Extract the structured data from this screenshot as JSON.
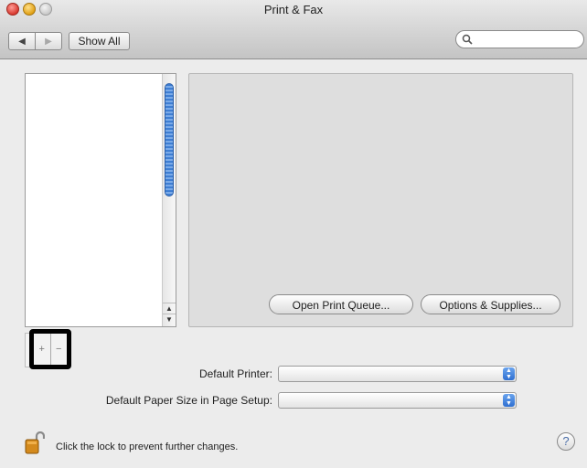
{
  "window": {
    "title": "Print & Fax"
  },
  "toolbar": {
    "back_icon": "left-triangle-icon",
    "forward_icon": "right-triangle-icon",
    "back_glyph": "◀",
    "forward_glyph": "▶",
    "show_all_label": "Show All",
    "search_placeholder": "",
    "search_glyph": "🔍"
  },
  "printer_list": {
    "items": []
  },
  "list_buttons": {
    "add_label": "+",
    "remove_label": "−"
  },
  "detail": {
    "open_queue_label": "Open Print Queue...",
    "options_label": "Options & Supplies..."
  },
  "settings": {
    "default_printer_label": "Default Printer:",
    "default_printer_value": "",
    "paper_size_label": "Default Paper Size in Page Setup:",
    "paper_size_value": ""
  },
  "footer": {
    "lock_text": "Click the lock to prevent further changes.",
    "help_label": "?"
  },
  "colors": {
    "titlebar": "#d4d4d4",
    "window_bg": "#ececec",
    "scroll_thumb": "#3e7ed3",
    "highlight_box": "#000000"
  }
}
